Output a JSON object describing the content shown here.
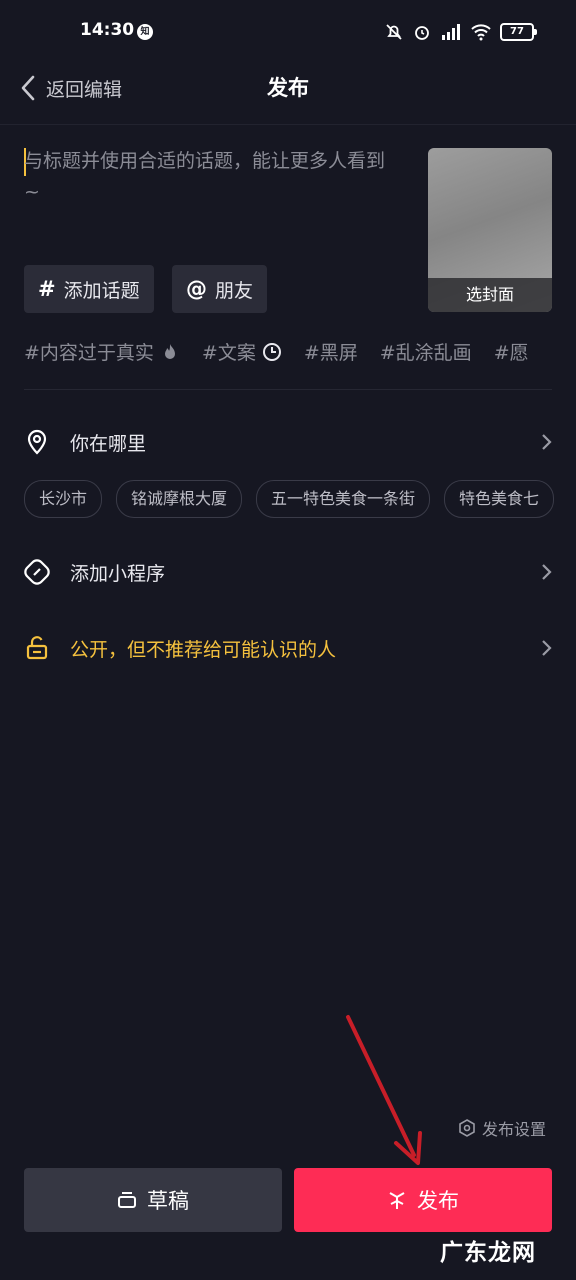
{
  "status_bar": {
    "time": "14:30",
    "notification_badge": "知",
    "battery": "77"
  },
  "header": {
    "back_label": "返回编辑",
    "title": "发布"
  },
  "caption": {
    "placeholder": "写标题并使用合适的话题，能让更多人看到 ~",
    "display_text": "与标题并使用合适的话题，能让更多人看到 ~"
  },
  "cover": {
    "label": "选封面"
  },
  "chips": [
    {
      "symbol": "#",
      "label": "添加话题"
    },
    {
      "symbol": "@",
      "label": "朋友"
    }
  ],
  "hashtags": [
    {
      "text": "#内容过于真实",
      "icon": "fire-icon"
    },
    {
      "text": "#文案",
      "icon": "clock-icon"
    },
    {
      "text": "#黑屏",
      "icon": ""
    },
    {
      "text": "#乱涂乱画",
      "icon": ""
    },
    {
      "text": "#愿",
      "icon": ""
    }
  ],
  "location": {
    "label": "你在哪里",
    "suggestions": [
      "长沙市",
      "铭诚摩根大厦",
      "五一特色美食一条街",
      "特色美食七"
    ]
  },
  "mini_program": {
    "label": "添加小程序"
  },
  "privacy": {
    "label": "公开，但不推荐给可能认识的人",
    "color": "#f5c13e"
  },
  "footer": {
    "settings_label": "发布设置",
    "draft_label": "草稿",
    "publish_label": "发布",
    "publish_color": "#fe2c55"
  },
  "watermark": "广东龙网"
}
